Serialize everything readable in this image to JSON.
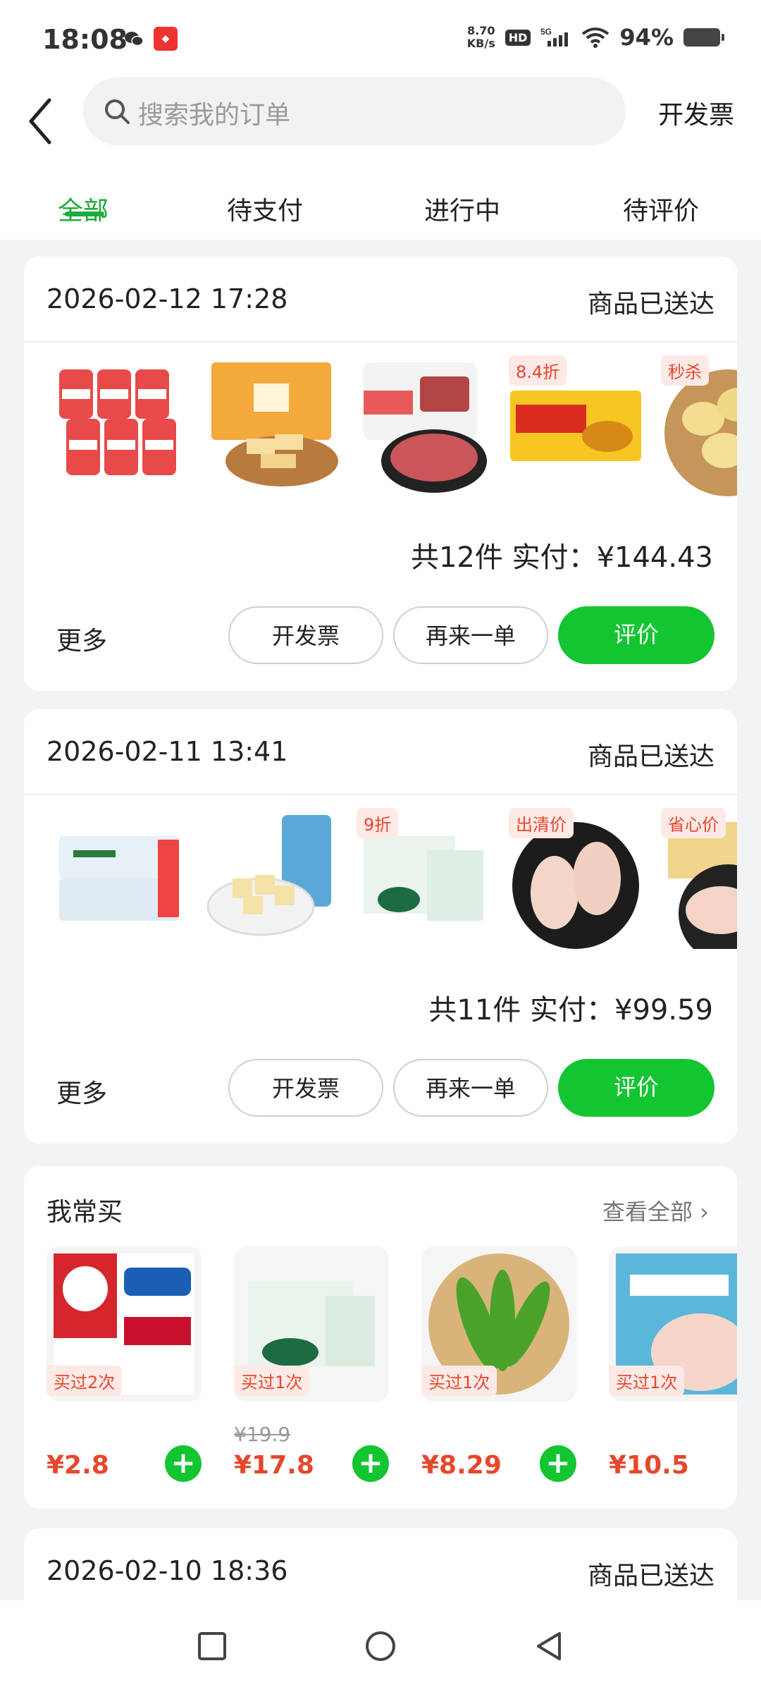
{
  "status_bar": {
    "time": "18:08",
    "speed_value": "8.70",
    "speed_unit": "KB/s",
    "hd": "HD",
    "network": "5G",
    "battery": "94%"
  },
  "header": {
    "search_placeholder": "搜索我的订单",
    "invoice_label": "开发票"
  },
  "tabs": [
    {
      "label": "全部",
      "active": true
    },
    {
      "label": "待支付",
      "active": false
    },
    {
      "label": "进行中",
      "active": false
    },
    {
      "label": "待评价",
      "active": false
    }
  ],
  "orders": [
    {
      "date": "2026-02-12 17:28",
      "status": "商品已送达",
      "summary": "共12件  实付：¥144.43",
      "tags": [
        "",
        "",
        "",
        "8.4折",
        "秒杀"
      ],
      "more": "更多",
      "btn_invoice": "开发票",
      "btn_reorder": "再来一单",
      "btn_review": "评价"
    },
    {
      "date": "2026-02-11 13:41",
      "status": "商品已送达",
      "summary": "共11件  实付：¥99.59",
      "tags": [
        "",
        "",
        "9折",
        "出清价",
        "省心价"
      ],
      "more": "更多",
      "btn_invoice": "开发票",
      "btn_reorder": "再来一单",
      "btn_review": "评价"
    },
    {
      "date": "2026-02-10 18:36",
      "status": "商品已送达"
    }
  ],
  "favorites": {
    "title": "我常买",
    "view_all": "查看全部 ›",
    "items": [
      {
        "badge": "买过2次",
        "old_price": "",
        "price": "¥2.8"
      },
      {
        "badge": "买过1次",
        "old_price": "¥19.9",
        "price": "¥17.8"
      },
      {
        "badge": "买过1次",
        "old_price": "",
        "price": "¥8.29"
      },
      {
        "badge": "买过1次",
        "old_price": "",
        "price": "¥10.5"
      }
    ]
  },
  "colors": {
    "accent": "#1fab3b",
    "button_green": "#13c531",
    "price_red": "#e5482c"
  }
}
